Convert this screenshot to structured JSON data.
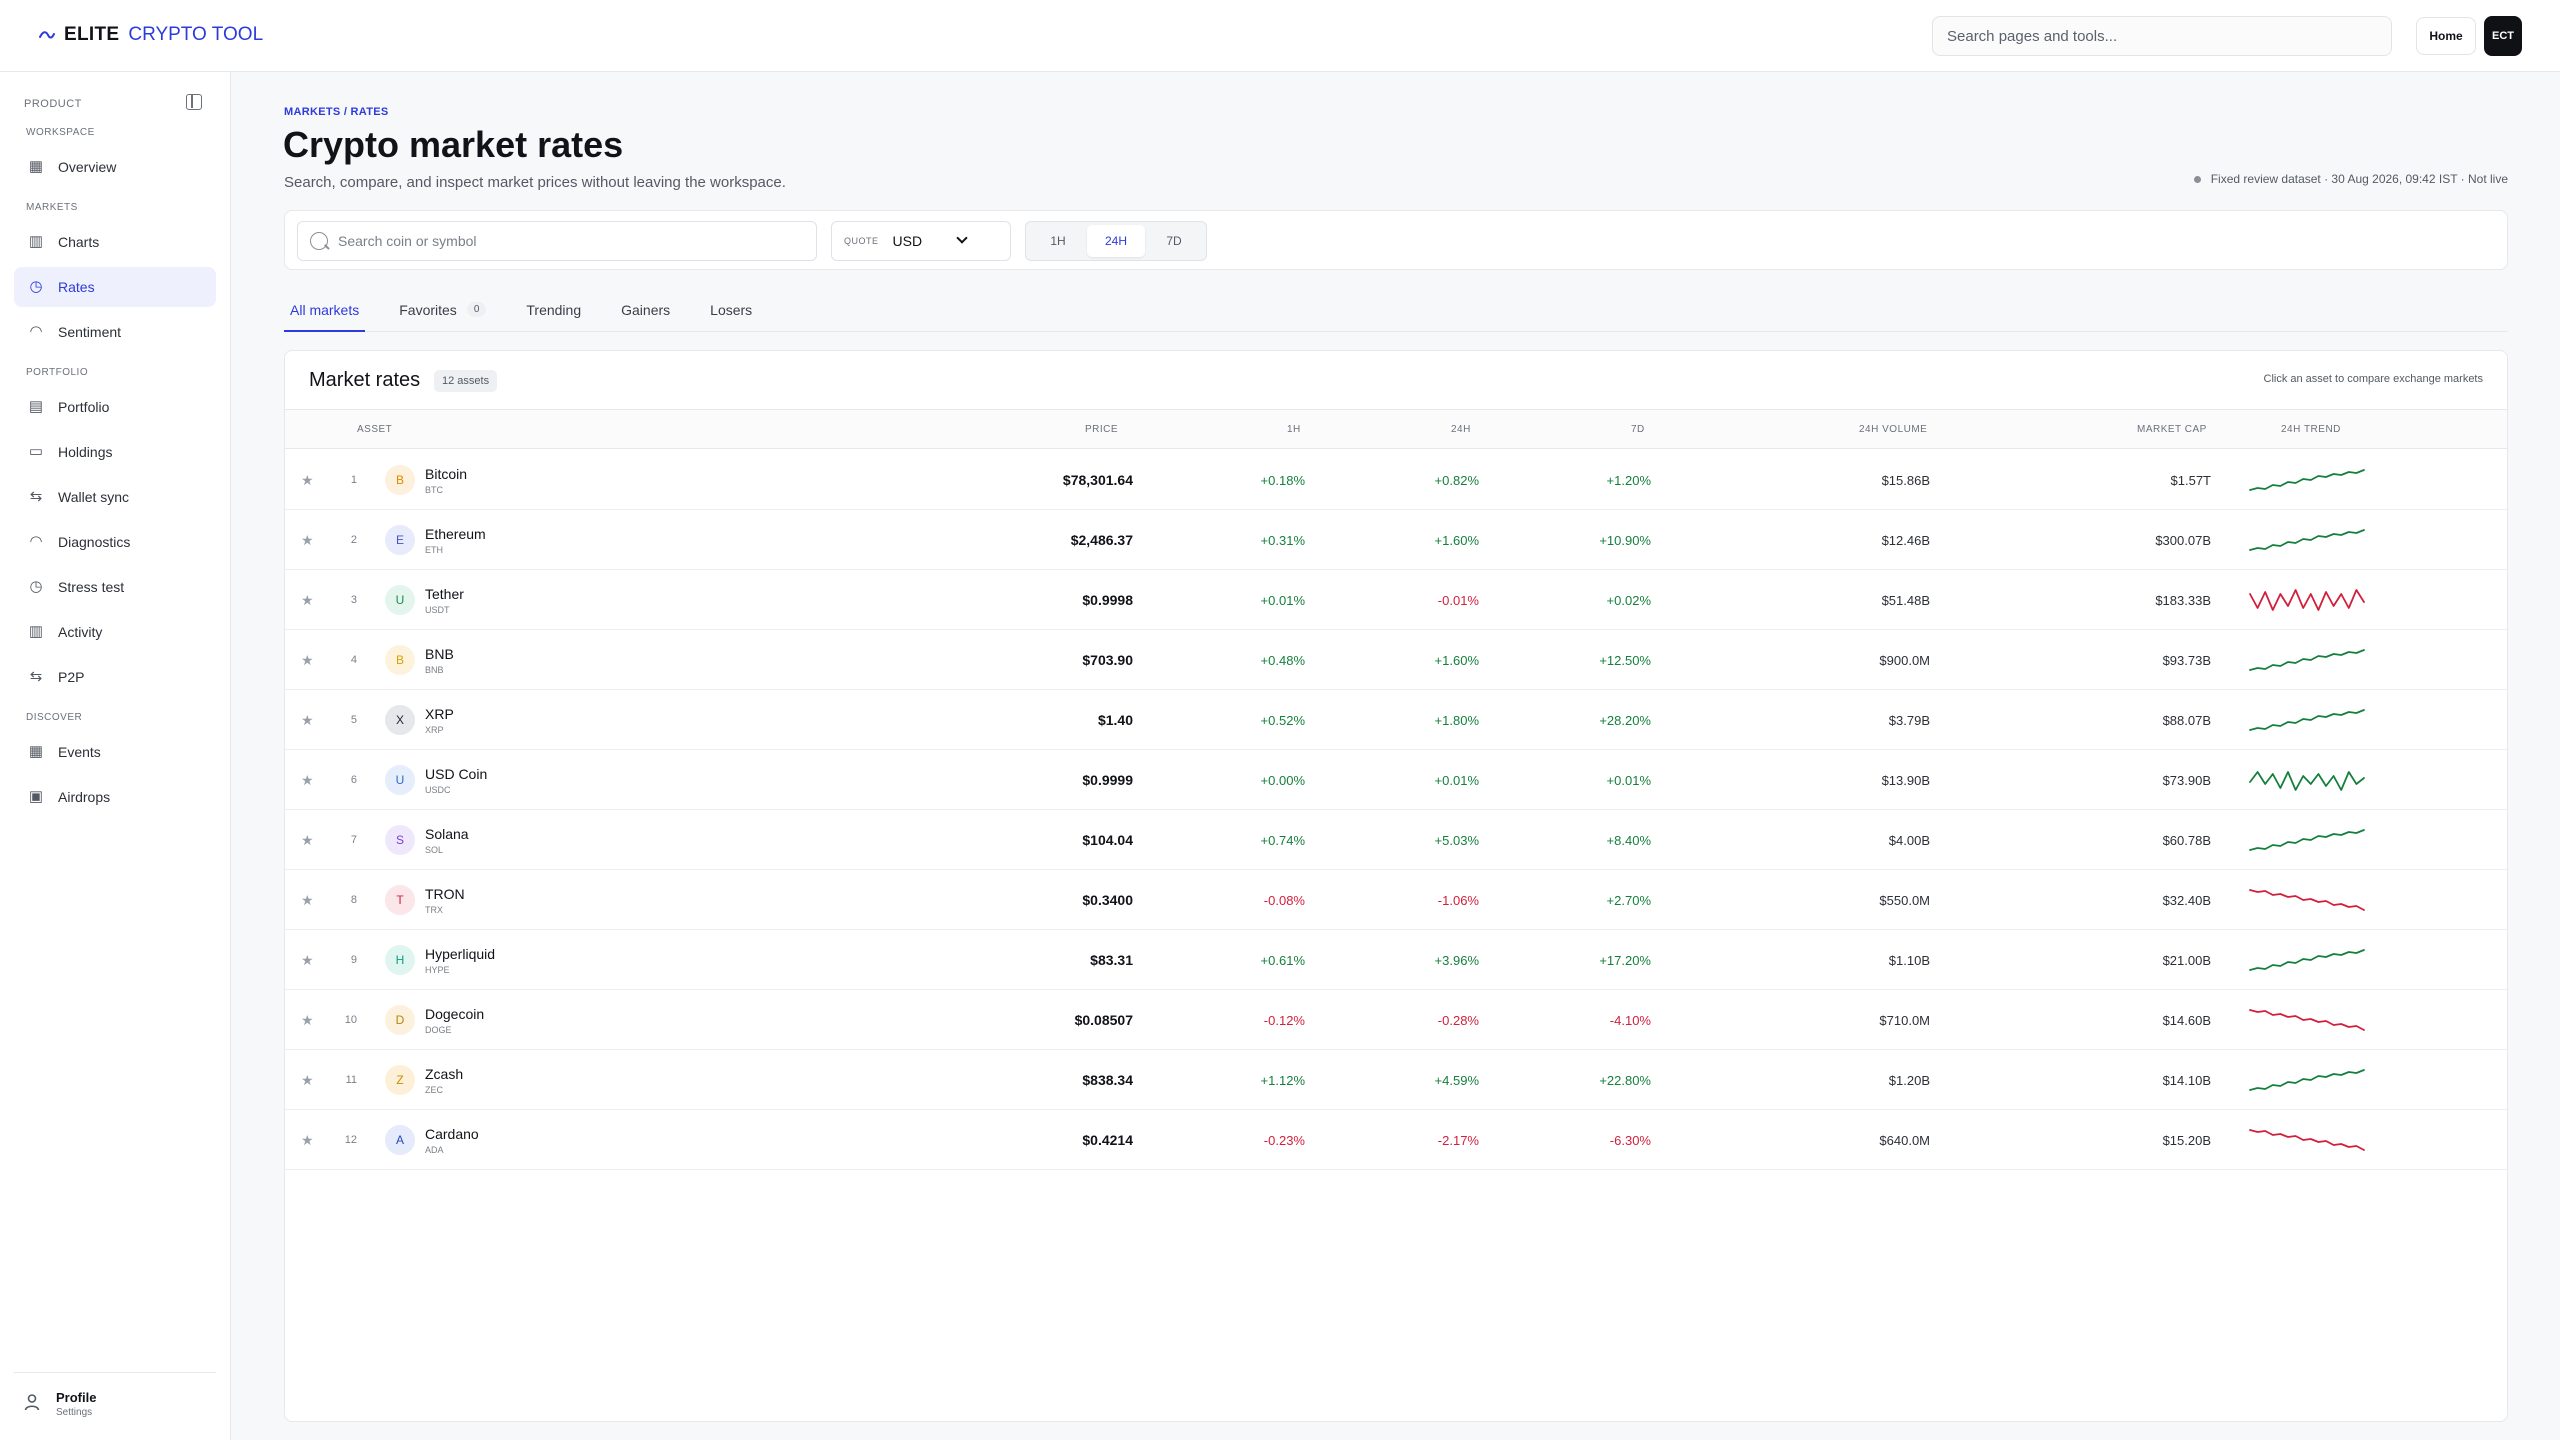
{
  "header": {
    "brand_primary": "ELITE",
    "brand_secondary": "CRYPTO TOOL",
    "search_placeholder": "Search pages and tools...",
    "home_label": "Home",
    "avatar_initials": "ECT"
  },
  "sidebar": {
    "title": "PRODUCT",
    "sections": {
      "workspace": "WORKSPACE",
      "markets": "MARKETS",
      "portfolio": "PORTFOLIO",
      "discover": "DISCOVER"
    },
    "items": [
      {
        "label": "Overview",
        "icon": "grid-icon"
      },
      {
        "label": "Charts",
        "icon": "bar-chart-icon"
      },
      {
        "label": "Rates",
        "icon": "gauge-icon",
        "active": true
      },
      {
        "label": "Sentiment",
        "icon": "meter-icon"
      },
      {
        "label": "Portfolio",
        "icon": "briefcase-icon"
      },
      {
        "label": "Holdings",
        "icon": "wallet-icon"
      },
      {
        "label": "Wallet sync",
        "icon": "swap-icon"
      },
      {
        "label": "Diagnostics",
        "icon": "meter-icon"
      },
      {
        "label": "Stress test",
        "icon": "gauge-icon"
      },
      {
        "label": "Activity",
        "icon": "bar-chart-icon"
      },
      {
        "label": "P2P",
        "icon": "swap-icon"
      },
      {
        "label": "Events",
        "icon": "calendar-icon"
      },
      {
        "label": "Airdrops",
        "icon": "gift-icon"
      }
    ],
    "profile": {
      "name": "Profile",
      "sub": "Settings"
    }
  },
  "page": {
    "breadcrumb": "MARKETS / RATES",
    "title": "Crypto market rates",
    "subtitle": "Search, compare, and inspect market prices without leaving the workspace.",
    "dataset_note": "Fixed review dataset · 30 Aug 2026, 09:42 IST · Not live"
  },
  "filters": {
    "search_placeholder": "Search coin or symbol",
    "quote_label": "QUOTE",
    "quote_value": "USD",
    "timeframes": [
      "1H",
      "24H",
      "7D"
    ],
    "active_timeframe": "24H"
  },
  "tabs": [
    {
      "label": "All markets",
      "active": true
    },
    {
      "label": "Favorites",
      "badge": "0"
    },
    {
      "label": "Trending"
    },
    {
      "label": "Gainers"
    },
    {
      "label": "Losers"
    }
  ],
  "table": {
    "title": "Market rates",
    "count_badge": "12 assets",
    "hint": "Click an asset to compare exchange markets",
    "columns": {
      "asset": "ASSET",
      "price": "PRICE",
      "h1": "1H",
      "h24": "24H",
      "d7": "7D",
      "volume": "24H VOLUME",
      "mcap": "MARKET CAP",
      "trend": "24H TREND"
    },
    "colors": {
      "positive": "#15803d",
      "negative": "#d21f3c"
    },
    "rows": [
      {
        "rank": "1",
        "initial": "B",
        "name": "Bitcoin",
        "symbol": "BTC",
        "price": "$78,301.64",
        "h1": "+0.18%",
        "h24": "+0.82%",
        "d7": "+1.20%",
        "volume": "$15.86B",
        "mcap": "$1.57T",
        "trend": "up",
        "icon_bg": "#fdf0dc",
        "icon_fg": "#e08a00"
      },
      {
        "rank": "2",
        "initial": "E",
        "name": "Ethereum",
        "symbol": "ETH",
        "price": "$2,486.37",
        "h1": "+0.31%",
        "h24": "+1.60%",
        "d7": "+10.90%",
        "volume": "$12.46B",
        "mcap": "$300.07B",
        "trend": "up",
        "icon_bg": "#e8ebfb",
        "icon_fg": "#4453c9"
      },
      {
        "rank": "3",
        "initial": "U",
        "name": "Tether",
        "symbol": "USDT",
        "price": "$0.9998",
        "h1": "+0.01%",
        "h24": "-0.01%",
        "d7": "+0.02%",
        "volume": "$51.48B",
        "mcap": "$183.33B",
        "trend": "flat-neg",
        "icon_bg": "#e3f5ec",
        "icon_fg": "#1a8a55"
      },
      {
        "rank": "4",
        "initial": "B",
        "name": "BNB",
        "symbol": "BNB",
        "price": "$703.90",
        "h1": "+0.48%",
        "h24": "+1.60%",
        "d7": "+12.50%",
        "volume": "$900.0M",
        "mcap": "$93.73B",
        "trend": "up",
        "icon_bg": "#fdf3dc",
        "icon_fg": "#d9a200"
      },
      {
        "rank": "5",
        "initial": "X",
        "name": "XRP",
        "symbol": "XRP",
        "price": "$1.40",
        "h1": "+0.52%",
        "h24": "+1.80%",
        "d7": "+28.20%",
        "volume": "$3.79B",
        "mcap": "$88.07B",
        "trend": "up",
        "icon_bg": "#e6e7ea",
        "icon_fg": "#23262b"
      },
      {
        "rank": "6",
        "initial": "U",
        "name": "USD Coin",
        "symbol": "USDC",
        "price": "$0.9999",
        "h1": "+0.00%",
        "h24": "+0.01%",
        "d7": "+0.01%",
        "volume": "$13.90B",
        "mcap": "$73.90B",
        "trend": "flat-pos",
        "icon_bg": "#e6eefb",
        "icon_fg": "#2d6bcf"
      },
      {
        "rank": "7",
        "initial": "S",
        "name": "Solana",
        "symbol": "SOL",
        "price": "$104.04",
        "h1": "+0.74%",
        "h24": "+5.03%",
        "d7": "+8.40%",
        "volume": "$4.00B",
        "mcap": "$60.78B",
        "trend": "up",
        "icon_bg": "#efe8fb",
        "icon_fg": "#7b3fd6"
      },
      {
        "rank": "8",
        "initial": "T",
        "name": "TRON",
        "symbol": "TRX",
        "price": "$0.3400",
        "h1": "-0.08%",
        "h24": "-1.06%",
        "d7": "+2.70%",
        "volume": "$550.0M",
        "mcap": "$32.40B",
        "trend": "down",
        "icon_bg": "#fbe6e9",
        "icon_fg": "#d21f3c"
      },
      {
        "rank": "9",
        "initial": "H",
        "name": "Hyperliquid",
        "symbol": "HYPE",
        "price": "$83.31",
        "h1": "+0.61%",
        "h24": "+3.96%",
        "d7": "+17.20%",
        "volume": "$1.10B",
        "mcap": "$21.00B",
        "trend": "up",
        "icon_bg": "#dff6f0",
        "icon_fg": "#129c7c"
      },
      {
        "rank": "10",
        "initial": "D",
        "name": "Dogecoin",
        "symbol": "DOGE",
        "price": "$0.08507",
        "h1": "-0.12%",
        "h24": "-0.28%",
        "d7": "-4.10%",
        "volume": "$710.0M",
        "mcap": "$14.60B",
        "trend": "down",
        "icon_bg": "#fbf1dc",
        "icon_fg": "#b8860b"
      },
      {
        "rank": "11",
        "initial": "Z",
        "name": "Zcash",
        "symbol": "ZEC",
        "price": "$838.34",
        "h1": "+1.12%",
        "h24": "+4.59%",
        "d7": "+22.80%",
        "volume": "$1.20B",
        "mcap": "$14.10B",
        "trend": "up",
        "icon_bg": "#fcf0d8",
        "icon_fg": "#d08a00"
      },
      {
        "rank": "12",
        "initial": "A",
        "name": "Cardano",
        "symbol": "ADA",
        "price": "$0.4214",
        "h1": "-0.23%",
        "h24": "-2.17%",
        "d7": "-6.30%",
        "volume": "$640.0M",
        "mcap": "$15.20B",
        "trend": "down",
        "icon_bg": "#e6ebfb",
        "icon_fg": "#2745b8"
      }
    ]
  }
}
